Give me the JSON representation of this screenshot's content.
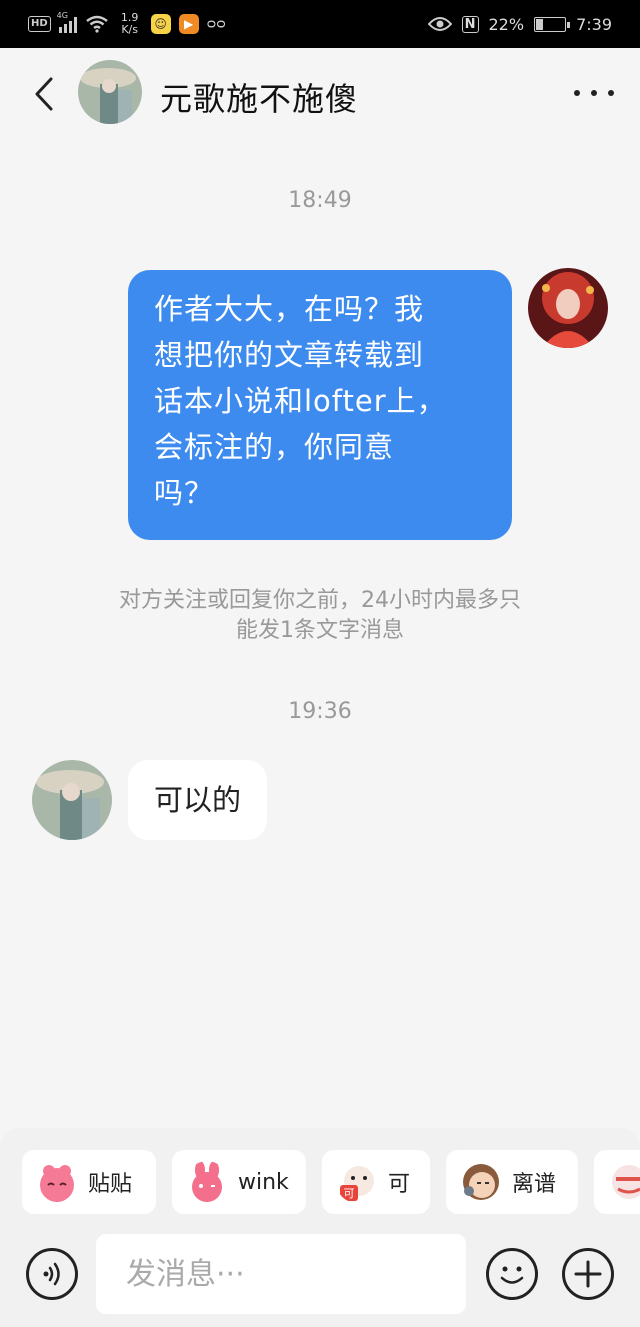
{
  "status_bar": {
    "hd": "HD",
    "network": "4G",
    "speed_value": "1.9",
    "speed_unit": "K/s",
    "nfc": "N",
    "battery": "22%",
    "battery_level": 0.22,
    "time": "7:39"
  },
  "header": {
    "title": "元歌施不施傻"
  },
  "messages": {
    "timestamp1": "18:49",
    "outgoing_lines": [
      "作者大大，在吗？我",
      "想把你的文章转载到",
      "话本小说和lofter上，",
      "会标注的，你同意",
      "吗？"
    ],
    "system_notice_line1": "对方关注或回复你之前，24小时内最多只",
    "system_notice_line2": "能发1条文字消息",
    "timestamp2": "19:36",
    "incoming_text": "可以的"
  },
  "stickers": [
    {
      "label": "贴贴",
      "icon": "pink-blob-sticker-icon"
    },
    {
      "label": "wink",
      "icon": "pink-bunny-sticker-icon"
    },
    {
      "label": "可",
      "icon": "red-bear-sticker-icon"
    },
    {
      "label": "离谱",
      "icon": "girl-face-sticker-icon"
    },
    {
      "label": "",
      "icon": "partial-sticker-icon"
    }
  ],
  "input": {
    "placeholder": "发消息···"
  },
  "colors": {
    "outgoing_bubble": "#3e8bef",
    "background": "#f5f5f5"
  }
}
